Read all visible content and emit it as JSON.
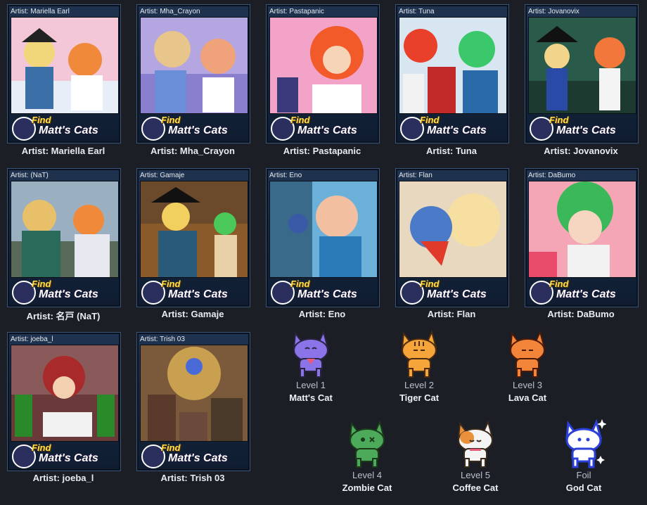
{
  "cards": [
    {
      "artist": "Artist: Mariella Earl",
      "caption": "Artist: Mariella Earl",
      "logo_find": "Find",
      "logo_name": "Matt's Cats"
    },
    {
      "artist": "Artist: Mha_Crayon",
      "caption": "Artist: Mha_Crayon",
      "logo_find": "Find",
      "logo_name": "Matt's Cats"
    },
    {
      "artist": "Artist: Pastapanic",
      "caption": "Artist: Pastapanic",
      "logo_find": "Find",
      "logo_name": "Matt's Cats"
    },
    {
      "artist": "Artist: Tuna",
      "caption": "Artist: Tuna",
      "logo_find": "Find",
      "logo_name": "Matt's Cats"
    },
    {
      "artist": "Artist: Jovanovix",
      "caption": "Artist: Jovanovix",
      "logo_find": "Find",
      "logo_name": "Matt's Cats"
    },
    {
      "artist": "Artist: (NaT)",
      "caption": "Artist: 名戸 (NaT)",
      "logo_find": "Find",
      "logo_name": "Matt's Cats"
    },
    {
      "artist": "Artist: Gamaje",
      "caption": "Artist: Gamaje",
      "logo_find": "Find",
      "logo_name": "Matt's Cats"
    },
    {
      "artist": "Artist: Eno",
      "caption": "Artist: Eno",
      "logo_find": "Find",
      "logo_name": "Matt's Cats"
    },
    {
      "artist": "Artist: Flan",
      "caption": "Artist: Flan",
      "logo_find": "Find",
      "logo_name": "Matt's Cats"
    },
    {
      "artist": "Artist: DaBumo",
      "caption": "Artist: DaBumo",
      "logo_find": "Find",
      "logo_name": "Matt's Cats"
    },
    {
      "artist": "Artist: joeba_l",
      "caption": "Artist: joeba_l",
      "logo_find": "Find",
      "logo_name": "Matt's Cats"
    },
    {
      "artist": "Artist: Trish 03",
      "caption": "Artist: Trish 03",
      "logo_find": "Find",
      "logo_name": "Matt's Cats"
    }
  ],
  "cats": [
    {
      "level": "Level 1",
      "name": "Matt's Cat",
      "icon": "purple-cat-icon",
      "color": "#8a74e8"
    },
    {
      "level": "Level 2",
      "name": "Tiger Cat",
      "icon": "tiger-cat-icon",
      "color": "#f5a53a"
    },
    {
      "level": "Level 3",
      "name": "Lava Cat",
      "icon": "lava-cat-icon",
      "color": "#f2853a"
    },
    {
      "level": "Level 4",
      "name": "Zombie Cat",
      "icon": "zombie-cat-icon",
      "color": "#4caa5a"
    },
    {
      "level": "Level 5",
      "name": "Coffee Cat",
      "icon": "coffee-cat-icon",
      "color": "#f4f4f4"
    },
    {
      "level": "Foil",
      "name": "God Cat",
      "icon": "god-cat-icon",
      "color": "#ffffff"
    }
  ]
}
